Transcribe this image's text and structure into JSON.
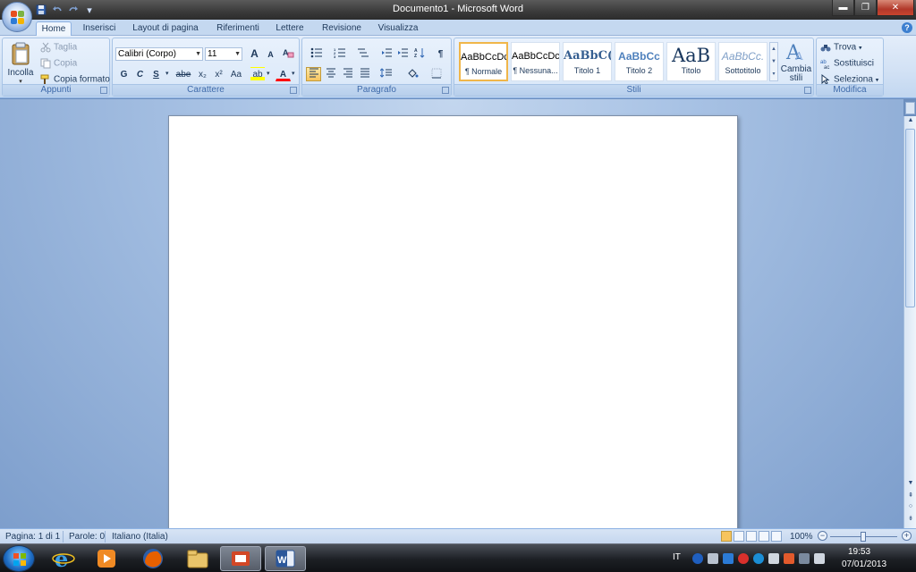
{
  "window": {
    "title": "Documento1 - Microsoft Word",
    "controls": {
      "minimize": "▬",
      "maximize": "❐",
      "close": "✕"
    }
  },
  "quick_access": {
    "save": "save-icon",
    "undo": "undo-icon",
    "redo": "redo-icon",
    "customize": "▾"
  },
  "tabs": [
    {
      "label": "Home",
      "active": true
    },
    {
      "label": "Inserisci"
    },
    {
      "label": "Layout di pagina"
    },
    {
      "label": "Riferimenti"
    },
    {
      "label": "Lettere"
    },
    {
      "label": "Revisione"
    },
    {
      "label": "Visualizza"
    }
  ],
  "help": "?",
  "ribbon": {
    "clipboard": {
      "label": "Appunti",
      "paste": "Incolla",
      "cut": "Taglia",
      "copy": "Copia",
      "format_painter": "Copia formato"
    },
    "font": {
      "label": "Carattere",
      "font_name": "Calibri (Corpo)",
      "font_size": "11",
      "grow": "A",
      "shrink": "A",
      "bold": "G",
      "italic": "C",
      "underline": "S",
      "strike": "abe",
      "subscript": "x₂",
      "superscript": "x²",
      "change_case": "Aa",
      "highlight": "ab",
      "font_color": "A"
    },
    "paragraph": {
      "label": "Paragrafo",
      "show_marks": "¶"
    },
    "styles": {
      "label": "Stili",
      "items": [
        {
          "preview": "AaBbCcDc",
          "name": "¶ Normale",
          "selected": true
        },
        {
          "preview": "AaBbCcDc",
          "name": "¶ Nessuna..."
        },
        {
          "preview": "AaBbC(",
          "name": "Titolo 1"
        },
        {
          "preview": "AaBbCc",
          "name": "Titolo 2"
        },
        {
          "preview": "AaB",
          "name": "Titolo"
        },
        {
          "preview": "AaBbCc.",
          "name": "Sottotitolo"
        }
      ],
      "change_styles": "Cambia stili"
    },
    "editing": {
      "label": "Modifica",
      "find": "Trova",
      "replace": "Sostituisci",
      "select": "Seleziona"
    }
  },
  "statusbar": {
    "page": "Pagina: 1 di 1",
    "words": "Parole: 0",
    "language": "Italiano (Italia)",
    "zoom": "100%",
    "zoom_minus": "−",
    "zoom_plus": "+"
  },
  "taskbar": {
    "apps": [
      "internet-explorer-icon",
      "media-player-icon",
      "firefox-icon",
      "explorer-icon",
      "powerpoint-icon",
      "word-icon"
    ],
    "lang": "IT",
    "time": "19:53",
    "date": "07/01/2013"
  },
  "colors": {
    "ribbon_blue": "#c4d8f0",
    "highlight_yellow": "#ffff00",
    "font_red": "#ff0000",
    "selection_gold": "#f7c45d"
  }
}
